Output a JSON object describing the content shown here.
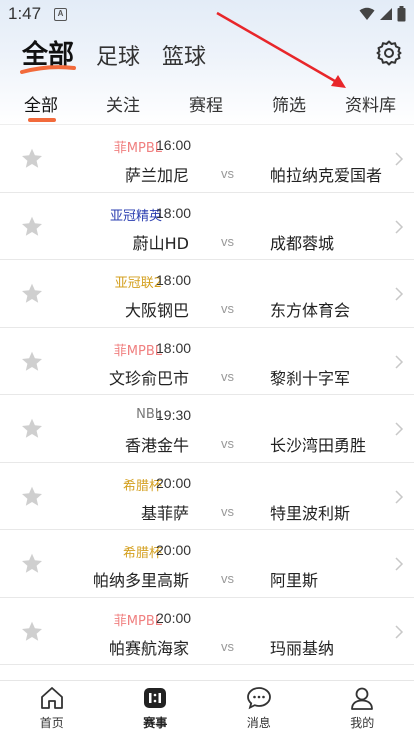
{
  "status_bar": {
    "time": "1:47",
    "notification_glyph": "A"
  },
  "top_tabs": [
    {
      "label": "全部",
      "active": true
    },
    {
      "label": "足球",
      "active": false
    },
    {
      "label": "篮球",
      "active": false
    }
  ],
  "sub_tabs": [
    {
      "label": "全部",
      "active": true
    },
    {
      "label": "关注",
      "active": false
    },
    {
      "label": "赛程",
      "active": false
    },
    {
      "label": "筛选",
      "active": false
    },
    {
      "label": "资料库",
      "active": false
    }
  ],
  "colors": {
    "accent": "#f26a3b",
    "arrow": "#e8262a",
    "league_pink": "#f08080",
    "league_blue": "#2a3db0",
    "league_gold": "#d4a020",
    "league_gray": "#777777"
  },
  "matches": [
    {
      "league": "菲MPBL",
      "league_color": "#f08080",
      "time": "16:00",
      "home": "萨兰加尼",
      "vs": "vs",
      "away": "帕拉纳克爱国者"
    },
    {
      "league": "亚冠精英",
      "league_color": "#2a3db0",
      "time": "18:00",
      "home": "蔚山HD",
      "vs": "vs",
      "away": "成都蓉城"
    },
    {
      "league": "亚冠联2",
      "league_color": "#d4a020",
      "time": "18:00",
      "home": "大阪钢巴",
      "vs": "vs",
      "away": "东方体育会"
    },
    {
      "league": "菲MPBL",
      "league_color": "#f08080",
      "time": "18:00",
      "home": "文珍俞巴市",
      "vs": "vs",
      "away": "黎刹十字军"
    },
    {
      "league": "NBL",
      "league_color": "#777777",
      "time": "19:30",
      "home": "香港金牛",
      "vs": "vs",
      "away": "长沙湾田勇胜"
    },
    {
      "league": "希腊杯",
      "league_color": "#d4a020",
      "time": "20:00",
      "home": "基菲萨",
      "vs": "vs",
      "away": "特里波利斯"
    },
    {
      "league": "希腊杯",
      "league_color": "#d4a020",
      "time": "20:00",
      "home": "帕纳多里高斯",
      "vs": "vs",
      "away": "阿里斯"
    },
    {
      "league": "菲MPBL",
      "league_color": "#f08080",
      "time": "20:00",
      "home": "帕赛航海家",
      "vs": "vs",
      "away": "玛丽基纳"
    }
  ],
  "bottom_nav": [
    {
      "label": "首页",
      "icon": "home-icon",
      "active": false
    },
    {
      "label": "赛事",
      "icon": "scoreboard-icon",
      "active": true
    },
    {
      "label": "消息",
      "icon": "chat-bubble-icon",
      "active": false
    },
    {
      "label": "我的",
      "icon": "person-icon",
      "active": false
    }
  ]
}
